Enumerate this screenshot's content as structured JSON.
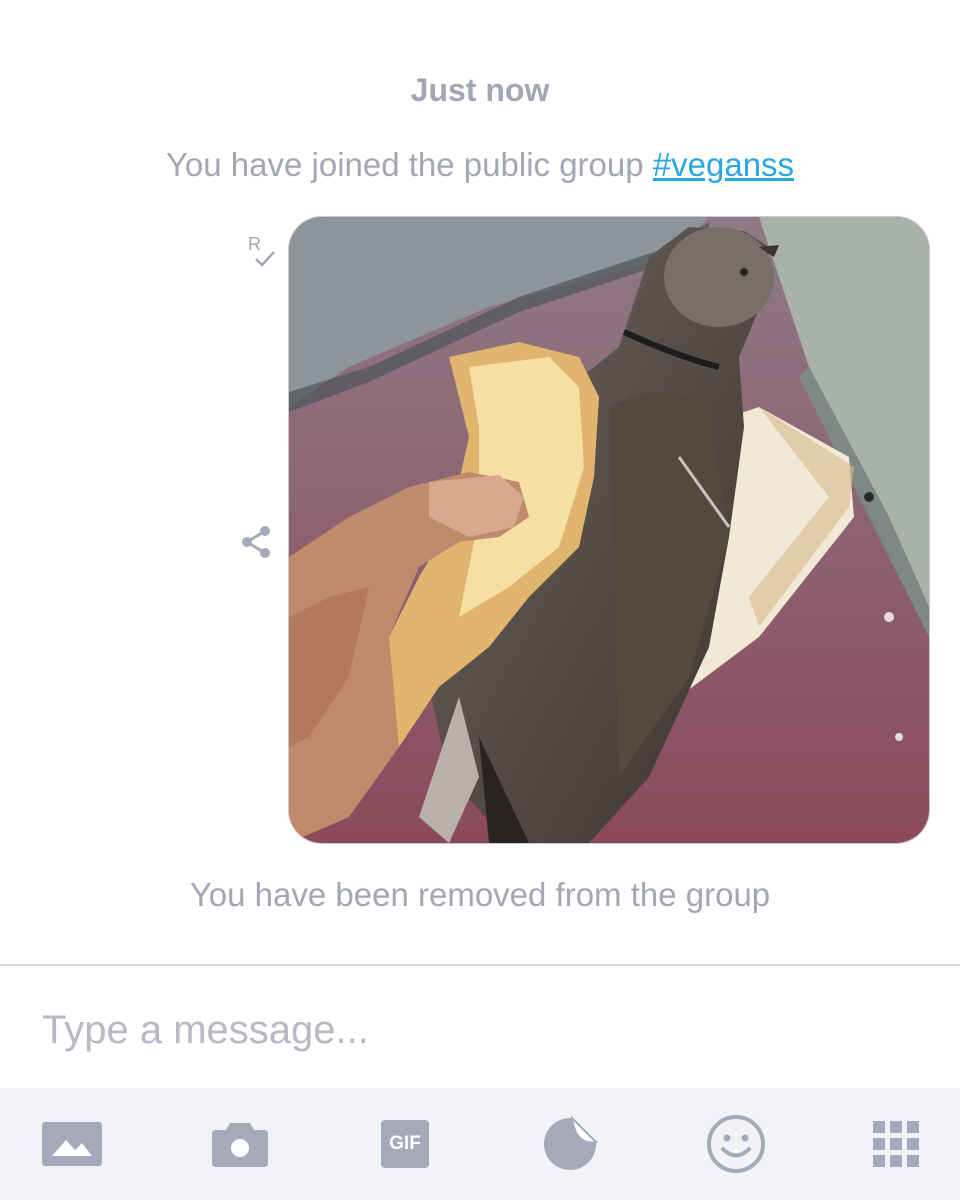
{
  "chat": {
    "timestamp": "Just now",
    "joined_text": "You have joined the public group ",
    "group_tag": "#veganss",
    "removed_text": "You have been removed from the group",
    "read_receipt": "R"
  },
  "composer": {
    "placeholder": "Type a message..."
  },
  "toolbar": {
    "items": [
      {
        "icon": "image-gallery-icon"
      },
      {
        "icon": "camera-icon"
      },
      {
        "icon": "gif-icon",
        "label": "GIF"
      },
      {
        "icon": "sticker-icon"
      },
      {
        "icon": "emoji-icon"
      },
      {
        "icon": "apps-grid-icon"
      }
    ]
  },
  "colors": {
    "system_text": "#a3a6b4",
    "link": "#2aa7de",
    "toolbar_bg": "#f2f3f6",
    "icon": "#a6a9ba"
  }
}
